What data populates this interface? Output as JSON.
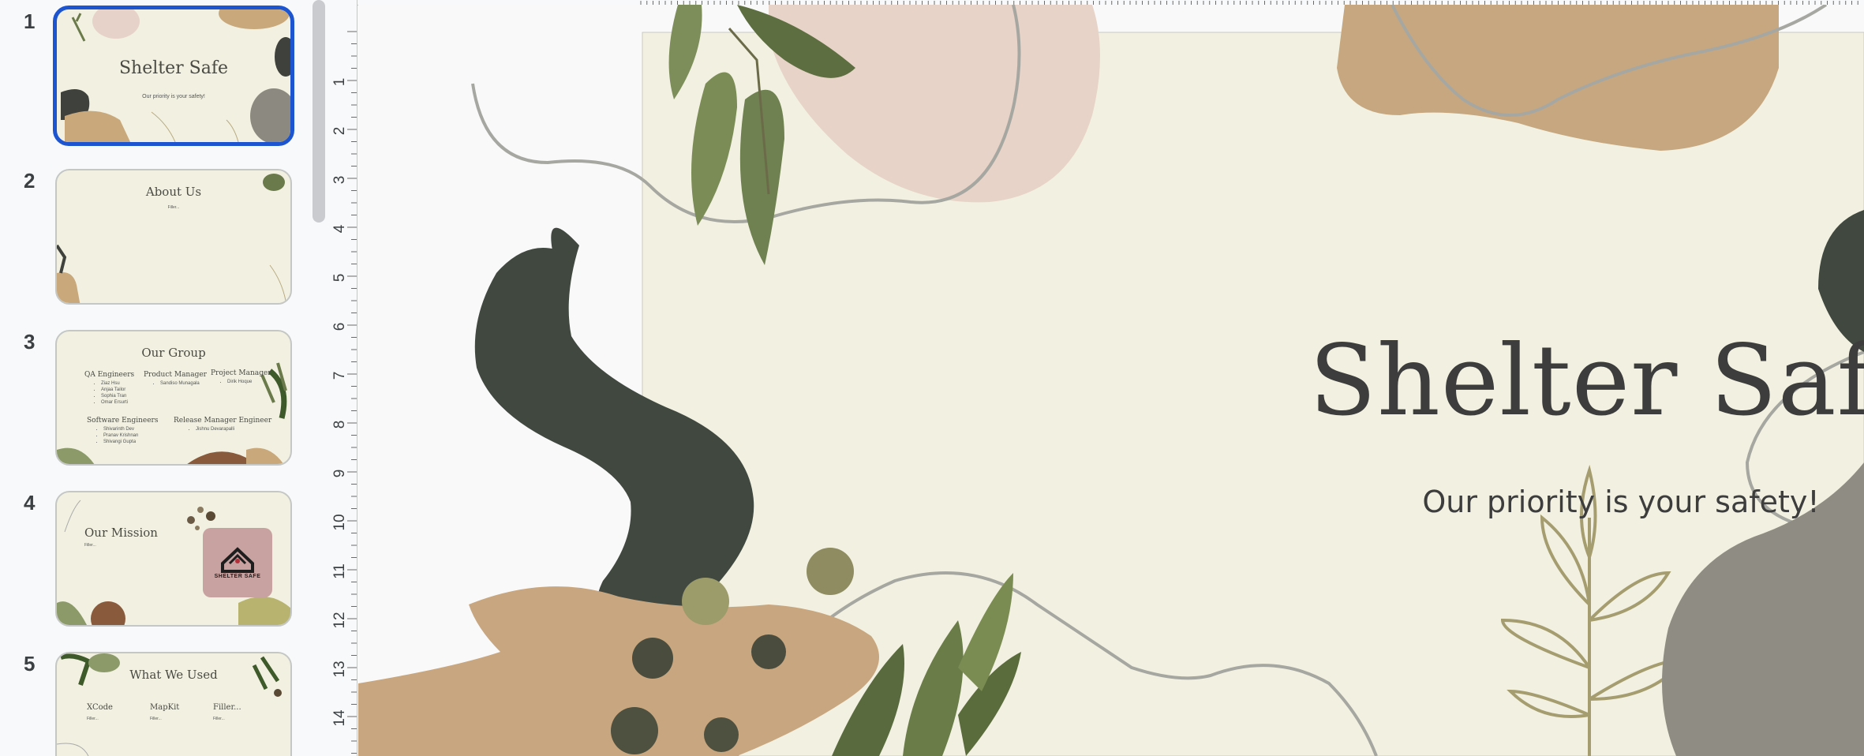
{
  "slides": [
    {
      "number": "1",
      "title": "Shelter Safe",
      "subtitle": "Our priority is your safety!"
    },
    {
      "number": "2",
      "title": "About Us",
      "filler": "Filler..."
    },
    {
      "number": "3",
      "title": "Our Group",
      "groups": [
        {
          "heading": "QA Engineers",
          "members": [
            "Ziaz Hsu",
            "Anjaa Tailor",
            "Sophia Tran",
            "Omar Ersurti"
          ]
        },
        {
          "heading": "Product Manager",
          "members": [
            "Sandiso Munagala"
          ]
        },
        {
          "heading": "Project Manager",
          "members": [
            "Dirik Hoque"
          ]
        },
        {
          "heading": "Software Engineers",
          "members": [
            "Shivarinth Dev",
            "Pranav Krishnan",
            "Shivangi Gupta"
          ]
        },
        {
          "heading": "Release Manager Engineer",
          "members": [
            "Jishnu Devarapalli"
          ]
        }
      ]
    },
    {
      "number": "4",
      "title": "Our Mission",
      "filler": "Filler...",
      "logo_text": "SHELTER SAFE"
    },
    {
      "number": "5",
      "title": "What We Used",
      "columns": [
        {
          "label": "XCode",
          "filler": "Filler..."
        },
        {
          "label": "MapKit",
          "filler": "Filler..."
        },
        {
          "label": "Filler...",
          "filler": "Filler..."
        }
      ]
    }
  ],
  "main_slide": {
    "title": "Shelter Safe",
    "subtitle": "Our priority is your safety!"
  },
  "ruler": {
    "labels": [
      "1",
      "2",
      "3",
      "4",
      "5",
      "6",
      "7",
      "8",
      "9",
      "10",
      "11",
      "12",
      "13",
      "14"
    ]
  },
  "colors": {
    "selection": "#1d55d0",
    "slide_bg": "#f2f1e1",
    "text": "#3d3d3d"
  }
}
